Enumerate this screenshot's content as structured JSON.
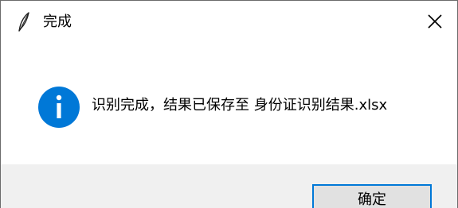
{
  "window": {
    "title": "完成",
    "app_icon": "feather-icon",
    "close_icon": "close-icon"
  },
  "message": {
    "icon": "info-icon",
    "text": "识别完成，结果已保存至 身份证识别结果.xlsx"
  },
  "buttons": {
    "ok_label": "确定"
  },
  "colors": {
    "info_icon_fill": "#0078d7",
    "button_focus_border": "#0078d7",
    "footer_background": "#f0f0f0"
  }
}
